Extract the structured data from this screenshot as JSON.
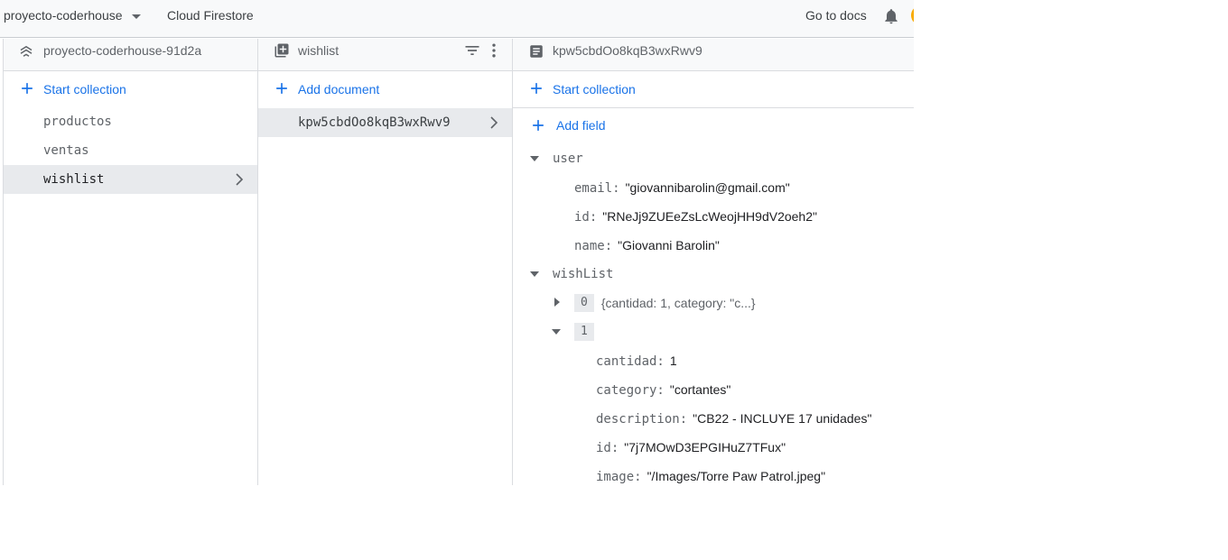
{
  "topbar": {
    "project": "proyecto-coderhouse",
    "product": "Cloud Firestore",
    "docs": "Go to docs"
  },
  "root_panel": {
    "header": "proyecto-coderhouse-91d2a",
    "action": "Start collection",
    "collections": [
      "productos",
      "ventas",
      "wishlist"
    ],
    "selected": "wishlist"
  },
  "collection_panel": {
    "header": "wishlist",
    "action": "Add document",
    "documents": [
      "kpw5cbdOo8kqB3wxRwv9"
    ]
  },
  "document_panel": {
    "header": "kpw5cbdOo8kqB3wxRwv9",
    "start_collection": "Start collection",
    "add_field": "Add field",
    "fields": {
      "user_key": "user",
      "email_key": "email:",
      "email_val": "\"giovannibarolin@gmail.com\"",
      "id_key": "id:",
      "id_val": "\"RNeJj9ZUEeZsLcWeojHH9dV2oeh2\"",
      "name_key": "name:",
      "name_val": "\"Giovanni Barolin\"",
      "wishlist_key": "wishList",
      "item0_idx": "0",
      "item0_preview": "{cantidad: 1, category: \"c...}",
      "item1_idx": "1",
      "cantidad_key": "cantidad:",
      "cantidad_val": "1",
      "category_key": "category:",
      "category_val": "\"cortantes\"",
      "description_key": "description:",
      "description_val": "\"CB22 - INCLUYE 17 unidades\"",
      "id2_key": "id:",
      "id2_val": "\"7j7MOwD3EPGIHuZ7TFux\"",
      "image_key": "image:",
      "image_val": "\"/Images/Torre Paw Patrol.jpeg\""
    }
  },
  "colors": {
    "accent": "#1a73e8",
    "selected_bg": "#e8eaed"
  }
}
